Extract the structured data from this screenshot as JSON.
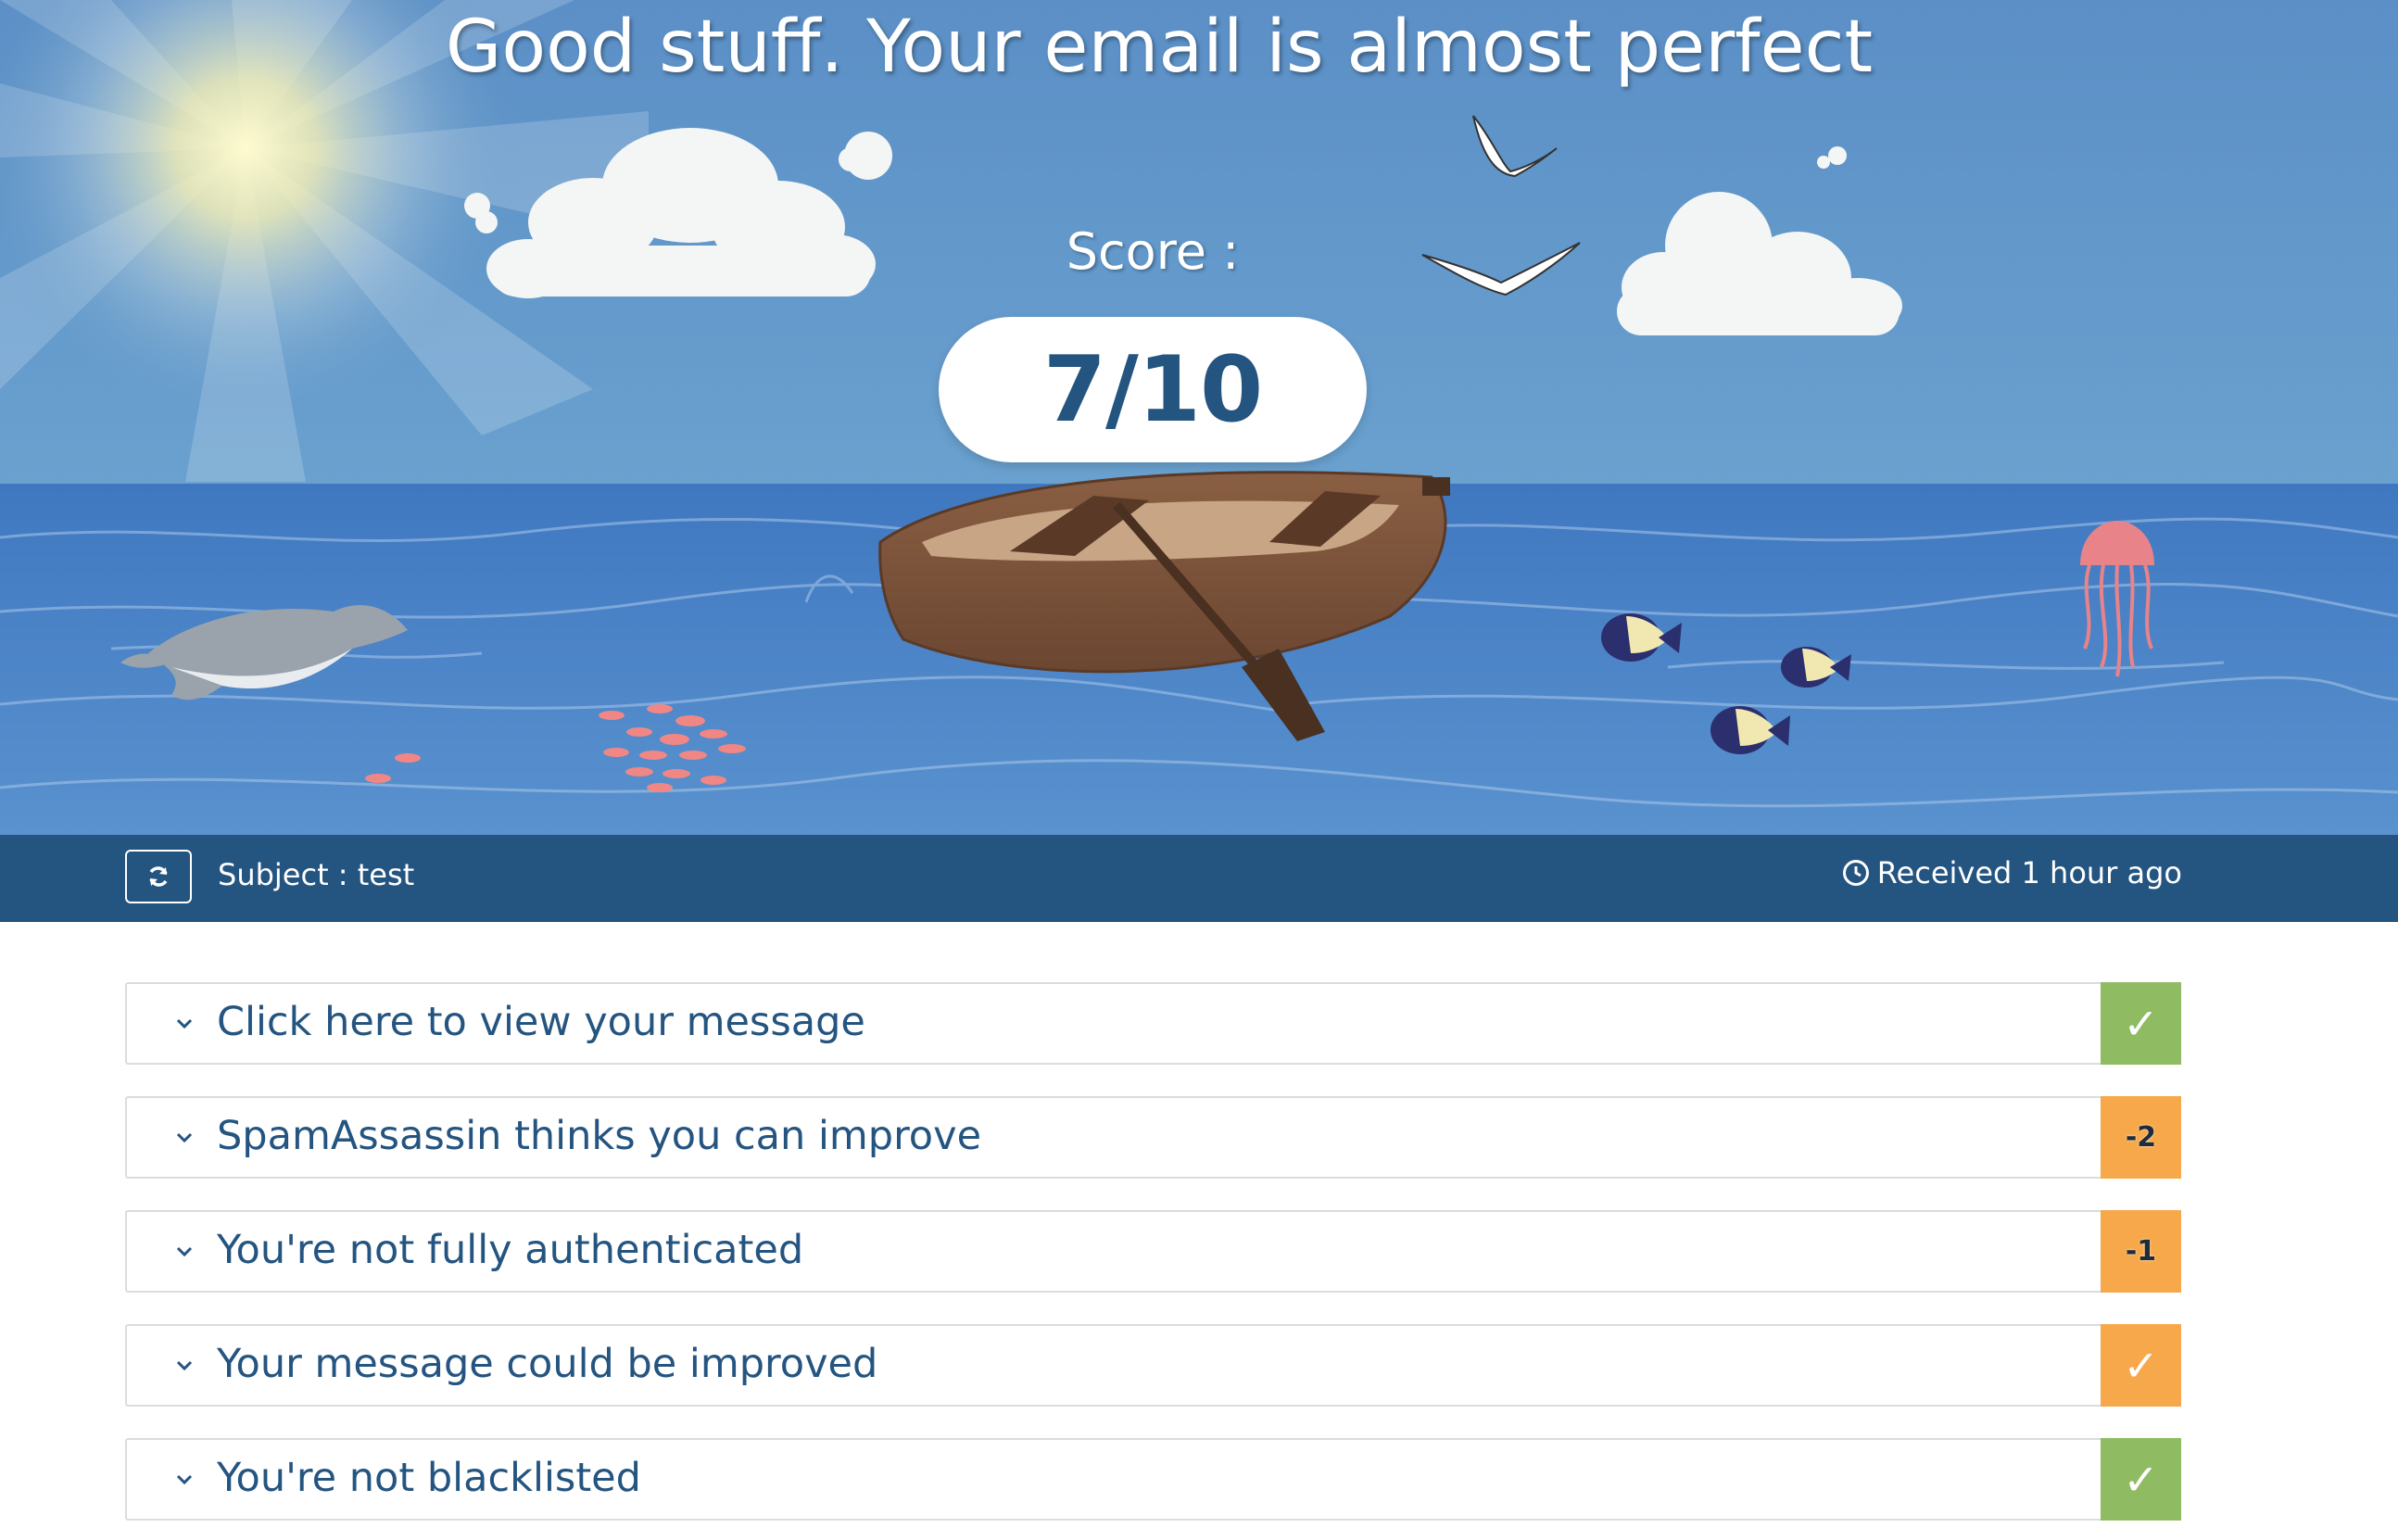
{
  "hero": {
    "title": "Good stuff. Your email is almost perfect",
    "score_label": "Score :",
    "score_value": "7/10",
    "score": 7,
    "score_max": 10
  },
  "info_bar": {
    "refresh_icon": "refresh-icon",
    "subject": "Subject : test",
    "received_icon": "clock-icon",
    "received": "Received 1 hour ago"
  },
  "checks": [
    {
      "label": "Click here to view your message",
      "badge": "✓",
      "status": "pass",
      "color": "#8fbb63"
    },
    {
      "label": "SpamAssassin thinks you can improve",
      "badge": "-2",
      "status": "warning",
      "color": "#f7a84a"
    },
    {
      "label": "You're not fully authenticated",
      "badge": "-1",
      "status": "warning",
      "color": "#f7a84a"
    },
    {
      "label": "Your message could be improved",
      "badge": "✓",
      "status": "warning",
      "color": "#f7a84a"
    },
    {
      "label": "You're not blacklisted",
      "badge": "✓",
      "status": "pass",
      "color": "#8fbb63"
    }
  ],
  "colors": {
    "sky": "#6399c8",
    "sea": "#4a80c4",
    "bar": "#245480",
    "pass": "#8fbb63",
    "warning": "#f7a84a",
    "text": "#245480"
  }
}
